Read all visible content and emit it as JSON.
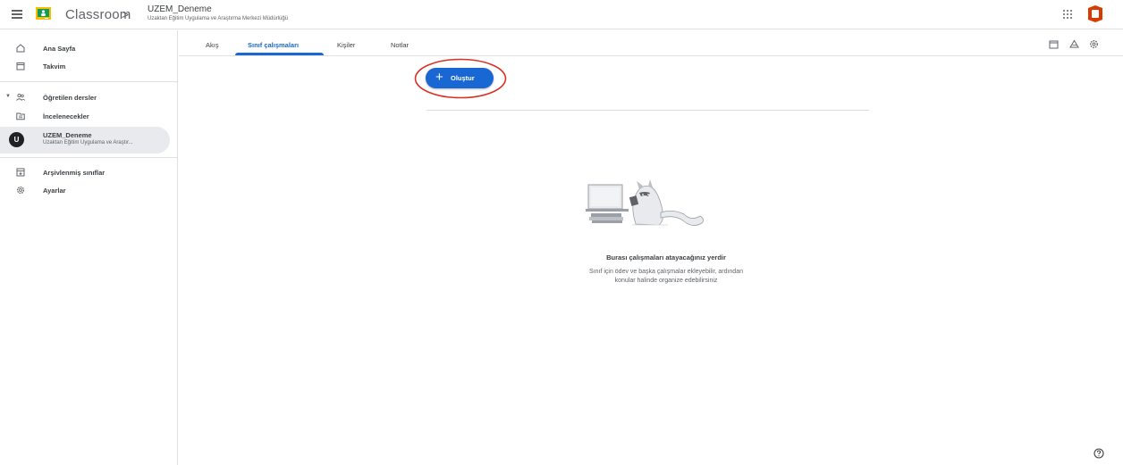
{
  "header": {
    "app_name": "Classroom",
    "breadcrumb_separator": ">",
    "course_title": "UZEM_Deneme",
    "course_subtitle": "Uzaktan Eğitim Uygulama ve Araştırma Merkezi Müdürlüğü"
  },
  "sidebar": {
    "items": [
      {
        "label": "Ana Sayfa",
        "icon": "home-icon"
      },
      {
        "label": "Takvim",
        "icon": "calendar-icon"
      },
      {
        "label": "Öğretilen dersler",
        "icon": "people-icon"
      },
      {
        "label": "İncelenecekler",
        "icon": "folder-icon"
      },
      {
        "label": "Arşivlenmiş sınıflar",
        "icon": "archive-icon"
      },
      {
        "label": "Ayarlar",
        "icon": "gear-icon"
      }
    ],
    "course": {
      "avatar_letter": "U",
      "name": "UZEM_Deneme",
      "subtitle": "Uzaktan Eğitim Uygulama ve Araştır..."
    }
  },
  "tabs": [
    {
      "label": "Akış"
    },
    {
      "label": "Sınıf çalışmaları",
      "active": true
    },
    {
      "label": "Kişiler"
    },
    {
      "label": "Notlar"
    }
  ],
  "main": {
    "create_button_label": "Oluştur",
    "empty_title": "Burası çalışmaları atayacağınız yerdir",
    "empty_desc_line1": "Sınıf için ödev ve başka çalışmalar ekleyebilir, ardından",
    "empty_desc_line2": "konular halinde organize edebilirsiniz"
  },
  "colors": {
    "accent": "#1967d2",
    "annotation": "#d93025"
  }
}
